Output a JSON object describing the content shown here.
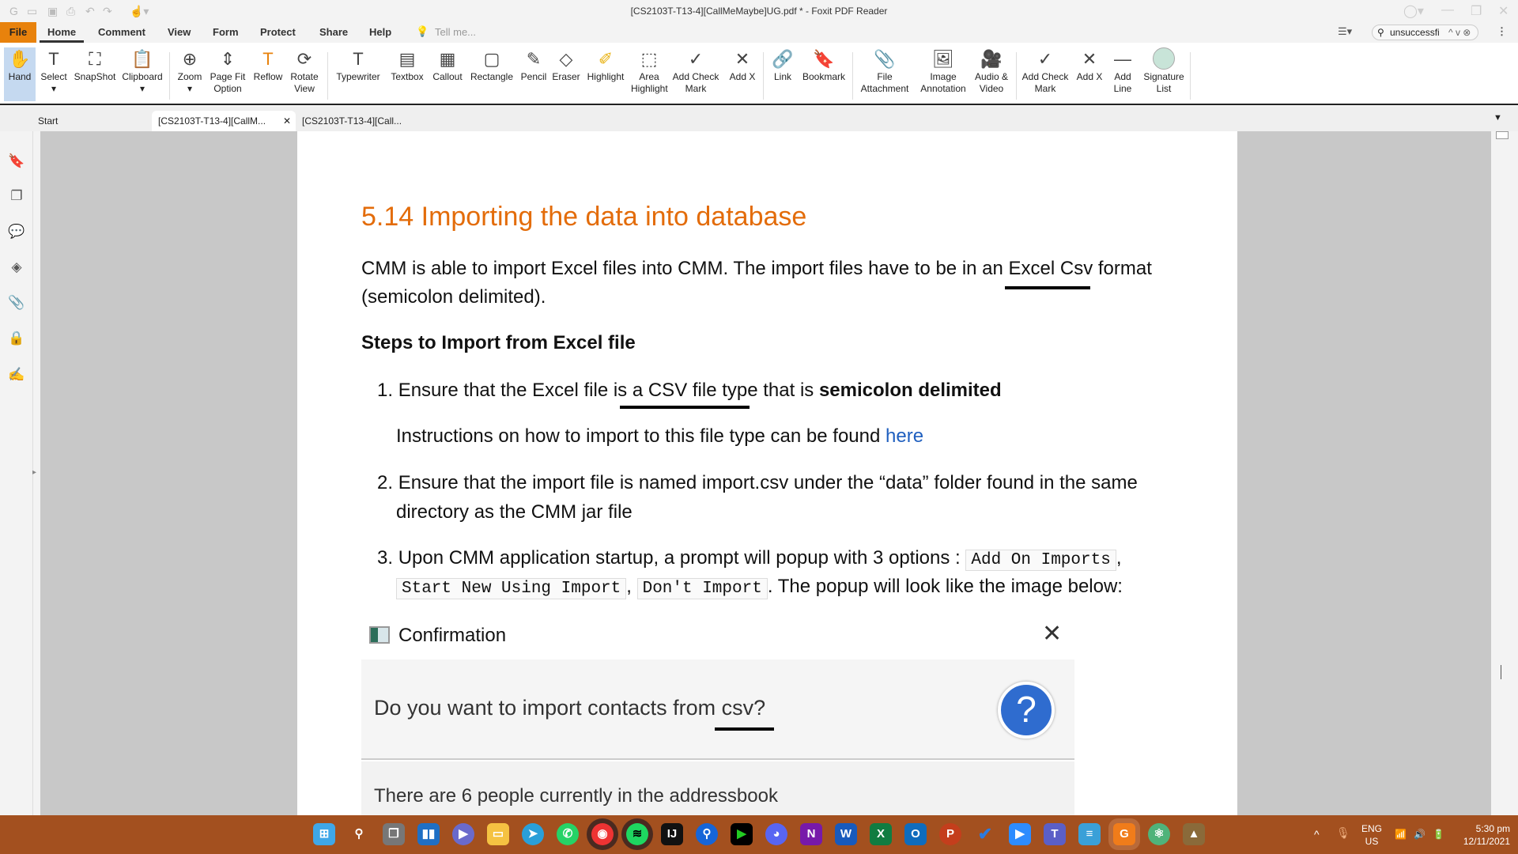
{
  "window": {
    "title": "[CS2103T-T13-4][CallMeMaybe]UG.pdf * - Foxit PDF Reader"
  },
  "menu": {
    "items": [
      "File",
      "Home",
      "Comment",
      "View",
      "Form",
      "Protect",
      "Share",
      "Help"
    ],
    "tell_me": "Tell me...",
    "search_value": "unsuccessfi"
  },
  "ribbon": {
    "tools": [
      {
        "label": "Hand"
      },
      {
        "label": "Select"
      },
      {
        "label": "SnapShot"
      },
      {
        "label": "Clipboard"
      },
      {
        "label": "Zoom"
      },
      {
        "label": "Page Fit Option"
      },
      {
        "label": "Reflow"
      },
      {
        "label": "Rotate View"
      },
      {
        "label": "Typewriter"
      },
      {
        "label": "Textbox"
      },
      {
        "label": "Callout"
      },
      {
        "label": "Rectangle"
      },
      {
        "label": "Pencil"
      },
      {
        "label": "Eraser"
      },
      {
        "label": "Highlight"
      },
      {
        "label": "Area Highlight"
      },
      {
        "label": "Add Check Mark"
      },
      {
        "label": "Add X"
      },
      {
        "label": "Link"
      },
      {
        "label": "Bookmark"
      },
      {
        "label": "File Attachment"
      },
      {
        "label": "Image Annotation"
      },
      {
        "label": "Audio & Video"
      },
      {
        "label": "Add Check Mark"
      },
      {
        "label": "Add X"
      },
      {
        "label": "Add Line"
      },
      {
        "label": "Signature List"
      }
    ]
  },
  "tabs": [
    {
      "label": "Start"
    },
    {
      "label": "[CS2103T-T13-4][CallM..."
    },
    {
      "label": "[CS2103T-T13-4][Call..."
    }
  ],
  "document": {
    "heading": "5.14 Importing the data into database",
    "intro_1": "CMM is able to import Excel files into CMM. The import files have to be in an Excel Csv format",
    "intro_2": "(semicolon delimited).",
    "steps_heading": "Steps to Import from Excel file",
    "step1_num": "1.",
    "step1_text": "Ensure that the Excel file is a CSV file type that is ",
    "step1_bold": "semicolon delimited",
    "step1_sub": "Instructions on how to import to this file type can be found ",
    "step1_link": "here",
    "step2_num": "2.",
    "step2_line1": "Ensure that the import file is named import.csv under the “data” folder found in the same",
    "step2_line2": "directory as the CMM jar file",
    "step3_num": "3.",
    "step3_pre": "Upon CMM application startup, a prompt will popup with 3 options : ",
    "opt1": "Add On Imports",
    "opt2": "Start New Using Import",
    "opt3": "Don't Import",
    "step3_post": ". The popup will look like the image below:",
    "dialog": {
      "title": "Confirmation",
      "question": "Do you want to import contacts from csv?",
      "info": "There are 6 people currently in the addressbook"
    }
  },
  "tray": {
    "lang": "ENG",
    "region": "US",
    "time": "5:30 pm",
    "date": "12/11/2021"
  },
  "colors": {
    "accent": "#e8820c",
    "heading": "#e36c0a",
    "taskbar": "#a3501f"
  }
}
